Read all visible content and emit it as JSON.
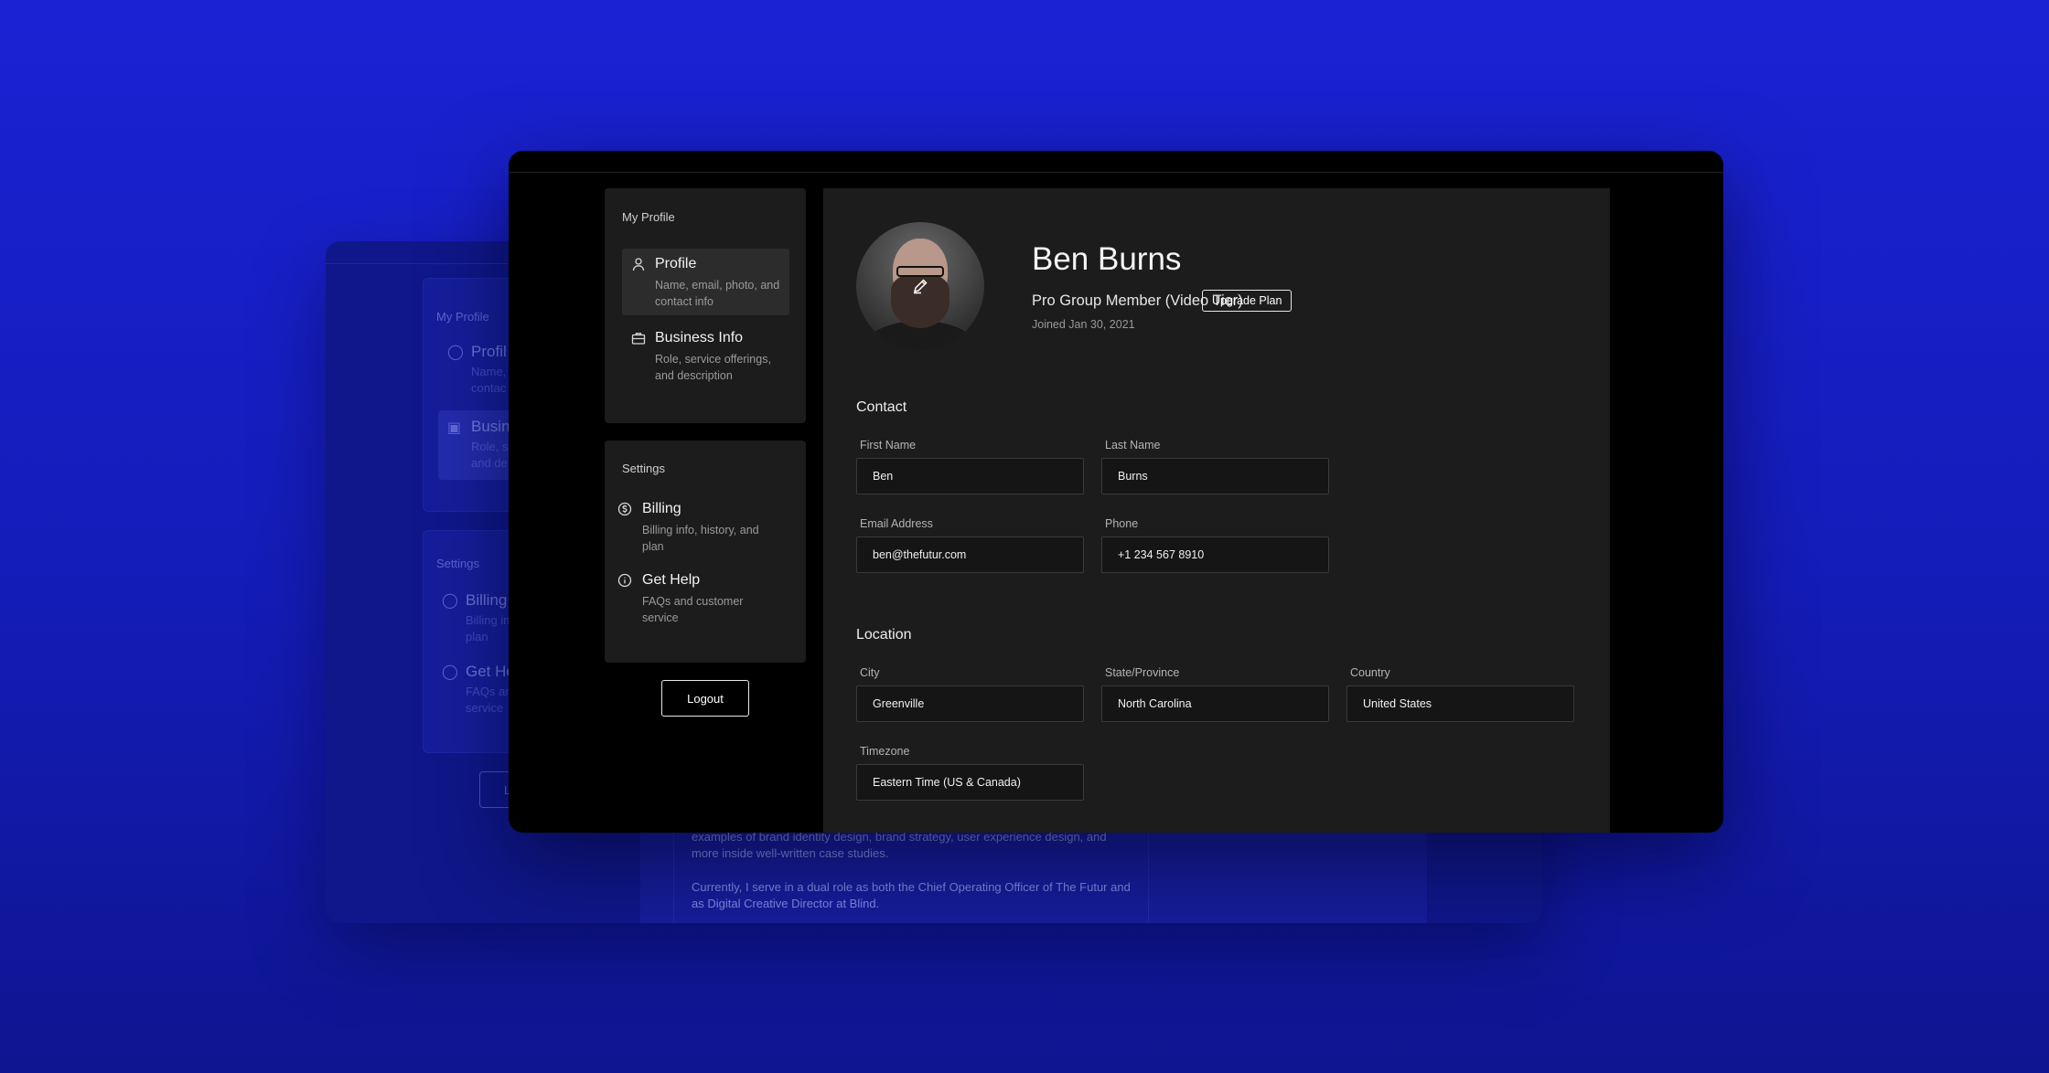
{
  "sidebar": {
    "profile_section_label": "My Profile",
    "items": [
      {
        "title": "Profile",
        "desc": "Name, email, photo, and contact info",
        "icon": "user-icon"
      },
      {
        "title": "Business Info",
        "desc": "Role, service offerings, and description",
        "icon": "briefcase-icon"
      }
    ],
    "settings_section_label": "Settings",
    "settings_items": [
      {
        "title": "Billing",
        "desc": "Billing info, history, and plan",
        "icon": "dollar-circle-icon"
      },
      {
        "title": "Get Help",
        "desc": "FAQs and customer service",
        "icon": "info-circle-icon"
      }
    ],
    "logout_label": "Logout"
  },
  "profile": {
    "name": "Ben Burns",
    "membership": "Pro Group Member (Video Tier)",
    "upgrade_label": "Upgrade Plan",
    "joined": "Joined Jan 30, 2021"
  },
  "contact": {
    "heading": "Contact",
    "first_name_label": "First Name",
    "first_name": "Ben",
    "last_name_label": "Last Name",
    "last_name": "Burns",
    "email_label": "Email Address",
    "email": "ben@thefutur.com",
    "phone_label": "Phone",
    "phone": "+1 234 567 8910"
  },
  "location": {
    "heading": "Location",
    "city_label": "City",
    "city": "Greenville",
    "state_label": "State/Province",
    "state": "North Carolina",
    "country_label": "Country",
    "country": "United States",
    "timezone_label": "Timezone",
    "timezone": "Eastern Time (US & Canada)"
  },
  "background_window": {
    "profile_section_label": "My Profile",
    "profile_item": "Profil",
    "profile_desc_1": "Name,",
    "profile_desc_2": "contac",
    "business_item": "Busin",
    "business_desc_1": "Role, s",
    "business_desc_2": "and de",
    "settings_section_label": "Settings",
    "billing_item": "Billing",
    "billing_desc_1": "Billing in",
    "billing_desc_2": "plan",
    "help_item": "Get He",
    "help_desc_1": "FAQs ar",
    "help_desc_2": "service",
    "logout_fragment": "L",
    "bio_line_1": "examples of brand identity design, brand strategy, user experience design, and",
    "bio_line_2": "more inside well-written case studies.",
    "bio_para_2": "Currently, I serve in a dual role as both the Chief Operating Officer of The Futur and as Digital Creative Director at Blind."
  },
  "colors": {
    "background": "#1a22d4",
    "window": "#000000",
    "panel": "#1c1c1c",
    "field": "#151515"
  }
}
